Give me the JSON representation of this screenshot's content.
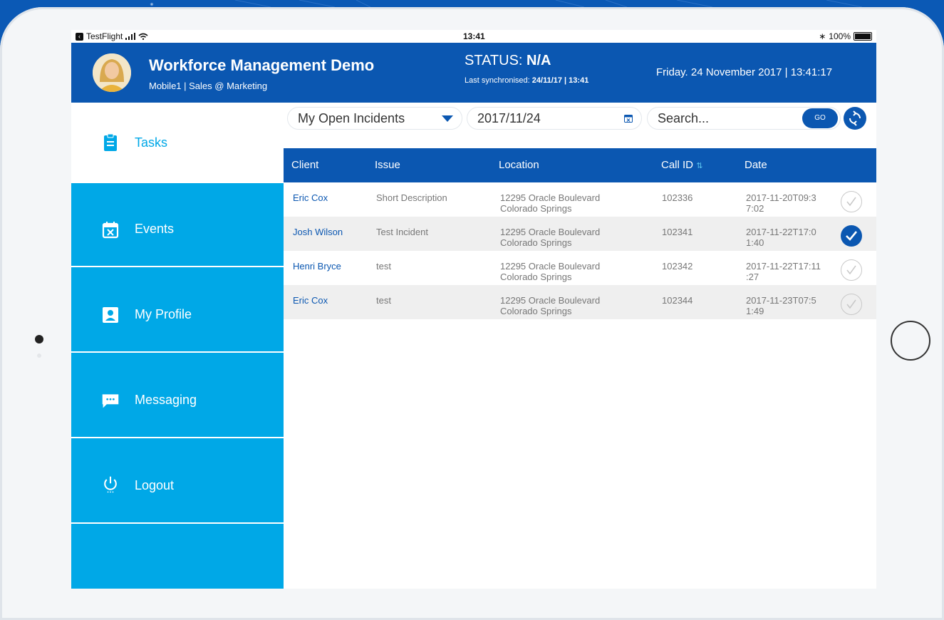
{
  "statusbar": {
    "carrier": "TestFlight",
    "time": "13:41",
    "battery": "100%"
  },
  "header": {
    "title": "Workforce Management Demo",
    "subtitle": "Mobile1 | Sales @ Marketing",
    "status_label": "STATUS:",
    "status_value": "N/A",
    "last_sync_label": "Last synchronised:",
    "last_sync_value": "24/11/17 | 13:41",
    "datetime": "Friday. 24 November 2017 | 13:41:17"
  },
  "sidebar": {
    "items": [
      {
        "label": "Tasks",
        "icon": "clipboard-icon"
      },
      {
        "label": "Events",
        "icon": "calendar-x-icon"
      },
      {
        "label": "My Profile",
        "icon": "profile-icon"
      },
      {
        "label": "Messaging",
        "icon": "chat-bubble-icon"
      },
      {
        "label": "Logout",
        "icon": "power-icon"
      }
    ]
  },
  "toolbar": {
    "filter_value": "My Open Incidents",
    "date_value": "2017/11/24",
    "search_placeholder": "Search...",
    "go_label": "GO"
  },
  "table": {
    "columns": [
      "Client",
      "Issue",
      "Location",
      "Call ID",
      "Date"
    ],
    "rows": [
      {
        "client": "Eric Cox",
        "issue": "Short Description",
        "loc1": "12295 Oracle Boulevard",
        "loc2": "Colorado Springs",
        "call_id": "102336",
        "date1": "2017-11-20T09:3",
        "date2": "7:02",
        "checked": false
      },
      {
        "client": "Josh Wilson",
        "issue": "Test Incident",
        "loc1": "12295 Oracle Boulevard",
        "loc2": "Colorado Springs",
        "call_id": "102341",
        "date1": "2017-11-22T17:0",
        "date2": "1:40",
        "checked": true
      },
      {
        "client": "Henri Bryce",
        "issue": "test",
        "loc1": "12295 Oracle Boulevard",
        "loc2": "Colorado Springs",
        "call_id": "102342",
        "date1": "2017-11-22T17:11",
        "date2": ":27",
        "checked": false
      },
      {
        "client": "Eric Cox",
        "issue": "test",
        "loc1": "12295 Oracle Boulevard",
        "loc2": "Colorado Springs",
        "call_id": "102344",
        "date1": "2017-11-23T07:5",
        "date2": "1:49",
        "checked": false
      }
    ]
  },
  "colors": {
    "header_blue": "#0b57b1",
    "sidebar_cyan": "#00a8e7",
    "row_alt": "#efefef"
  }
}
